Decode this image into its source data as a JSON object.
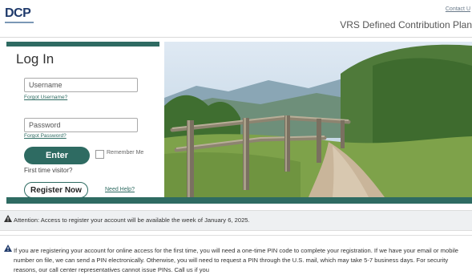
{
  "header": {
    "logo": "DCP",
    "contact_link": "Contact U",
    "plan_title": "VRS Defined Contribution Plan"
  },
  "login": {
    "title": "Log In",
    "username_placeholder": "Username",
    "forgot_username": "Forgot Username?",
    "password_placeholder": "Password",
    "forgot_password": "Forgot Password?",
    "enter_label": "Enter",
    "remember_label": "Remember Me",
    "first_time": "First time visitor?",
    "register_label": "Register Now",
    "need_help": "Need Help?"
  },
  "notices": {
    "attention": "Attention: Access to register your account will be available the week of January 6, 2025.",
    "pin_info": "If you are registering your account for online access for the first time, you will need a one-time PIN code to complete your registration. If we have your email or mobile number on file, we can send a PIN electronically. Otherwise, you will need to request a PIN through the U.S. mail, which may take 5-7 business days. For security reasons, our call center representatives cannot issue PINs. Call us if you"
  },
  "colors": {
    "brand_teal": "#2e6b62",
    "logo_navy": "#1f3a6b"
  },
  "icons": {
    "warning": "warning-icon",
    "hero": "hiking-trail-photo"
  }
}
